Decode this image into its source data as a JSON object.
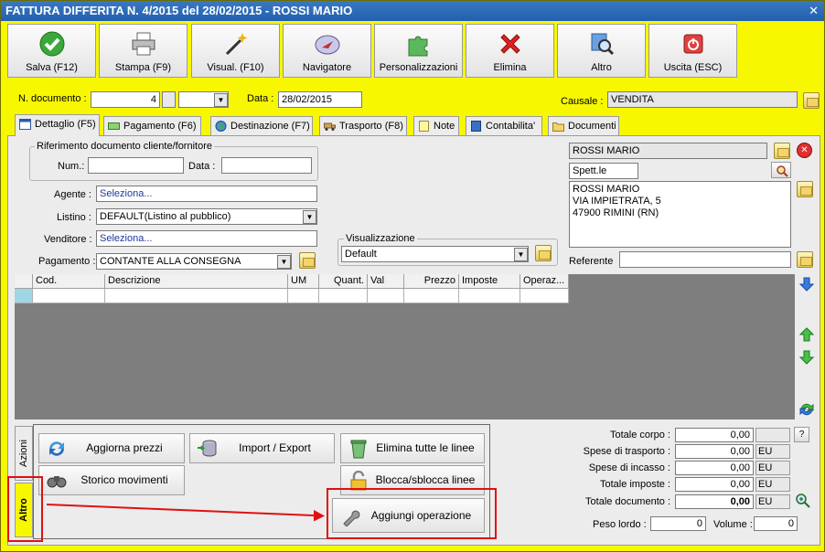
{
  "window": {
    "title": "FATTURA DIFFERITA N. 4/2015 del 28/02/2015 - ROSSI MARIO",
    "close_glyph": "✕"
  },
  "toolbar": [
    {
      "label": "Salva (F12)",
      "icon": "check-icon"
    },
    {
      "label": "Stampa (F9)",
      "icon": "printer-icon"
    },
    {
      "label": "Visual. (F10)",
      "icon": "magic-wand-icon"
    },
    {
      "label": "Navigatore",
      "icon": "compass-icon"
    },
    {
      "label": "Personalizzazioni",
      "icon": "puzzle-icon"
    },
    {
      "label": "Elimina",
      "icon": "red-x-icon"
    },
    {
      "label": "Altro",
      "icon": "magnifier-icon"
    },
    {
      "label": "Uscita (ESC)",
      "icon": "power-icon"
    }
  ],
  "header": {
    "num_doc_label": "N. documento :",
    "num_doc_value": "4",
    "data_label": "Data :",
    "data_value": "28/02/2015",
    "causale_label": "Causale :",
    "causale_value": "VENDITA"
  },
  "tabs": [
    {
      "label": "Dettaglio (F5)",
      "active": true
    },
    {
      "label": "Pagamento (F6)"
    },
    {
      "label": "Destinazione (F7)"
    },
    {
      "label": "Trasporto (F8)"
    },
    {
      "label": "Note"
    },
    {
      "label": "Contabilita'"
    },
    {
      "label": "Documenti"
    }
  ],
  "riferimento": {
    "title": "Riferimento documento cliente/fornitore",
    "num_label": "Num.:",
    "data_label": "Data :"
  },
  "fields": {
    "agente_label": "Agente :",
    "agente_value": "Seleziona...",
    "listino_label": "Listino :",
    "listino_value": "DEFAULT(Listino al pubblico)",
    "venditore_label": "Venditore :",
    "venditore_value": "Seleziona...",
    "pagamento_label": "Pagamento :",
    "pagamento_value": "CONTANTE ALLA CONSEGNA",
    "visualizzazione_title": "Visualizzazione",
    "visualizzazione_value": "Default"
  },
  "customer": {
    "name": "ROSSI MARIO",
    "title": "Spett.le",
    "address_lines": [
      "ROSSI MARIO",
      "VIA IMPIETRATA, 5",
      "47900 RIMINI (RN)"
    ],
    "referente_label": "Referente"
  },
  "grid": {
    "columns": [
      "Cod.",
      "Descrizione",
      "UM",
      "Quant.",
      "Val",
      "Prezzo",
      "Imposte",
      "Operaz..."
    ]
  },
  "side_tabs": [
    "Azioni",
    "Altro"
  ],
  "actions": [
    {
      "label": "Aggiorna prezzi",
      "icon": "refresh-icon"
    },
    {
      "label": "Import / Export",
      "icon": "database-icon"
    },
    {
      "label": "Elimina tutte le linee",
      "icon": "recycle-bin-icon"
    },
    {
      "label": "Storico movimenti",
      "icon": "binoculars-icon"
    },
    {
      "label": "Blocca/sblocca linee",
      "icon": "padlock-icon"
    },
    {
      "label": "Aggiungi operazione",
      "icon": "wrench-icon"
    }
  ],
  "totals": {
    "rows": [
      {
        "label": "Totale corpo :",
        "value": "0,00",
        "unit": ""
      },
      {
        "label": "Spese di trasporto :",
        "value": "0,00",
        "unit": "EU"
      },
      {
        "label": "Spese di incasso :",
        "value": "0,00",
        "unit": "EU"
      },
      {
        "label": "Totale imposte :",
        "value": "0,00",
        "unit": "EU"
      },
      {
        "label": "Totale documento :",
        "value": "0,00",
        "unit": "EU"
      }
    ],
    "help_label": "?",
    "peso_label": "Peso lordo :",
    "peso_value": "0",
    "volume_label": "Volume :",
    "volume_value": "0"
  },
  "colors": {
    "window_bg": "#f7f700",
    "titlebar": "#2a6cbc",
    "highlight": "#e01010",
    "grid_bg": "#7e7e7e"
  }
}
